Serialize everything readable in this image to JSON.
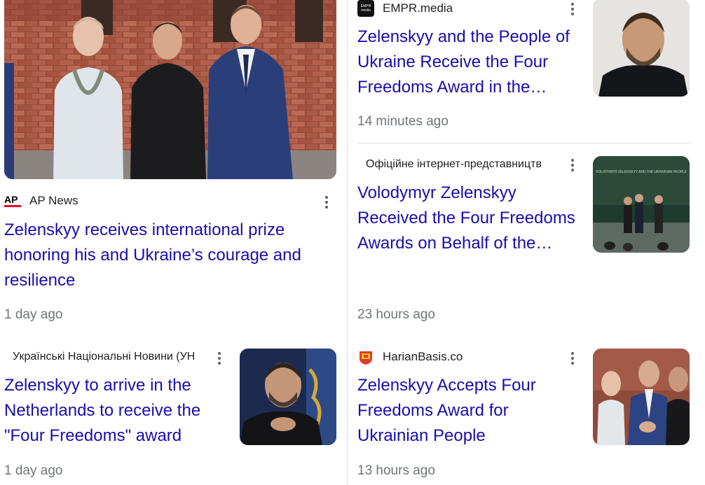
{
  "cards": [
    {
      "source": "AP News",
      "source_logo_text": "AP",
      "headline": "Zelenskyy receives international prize honoring his and Ukraine’s courage and resilience",
      "time": "1 day ago"
    },
    {
      "source": "EMPR.media",
      "source_logo_text": "EMPR media",
      "headline": "Zelenskyy and the People of Ukraine Receive the Four Freedoms Award in the…",
      "time": "14 minutes ago"
    },
    {
      "source": "Офіційне інтернет-представництв",
      "headline": "Volodymyr Zelenskyy Received the Four Freedoms Awards on Behalf of the…",
      "time": "23 hours ago",
      "thumb_caption": "VOLODYMYR ZELENSKYY AND THE UKRAINIAN PEOPLE"
    },
    {
      "source": "Українські Національні Новини (УН",
      "headline": "Zelenskyy to arrive in the Netherlands to receive the \"Four Freedoms\" award",
      "time": "1 day ago"
    },
    {
      "source": "HarianBasis.co",
      "headline": "Zelenskyy Accepts Four Freedoms Award for Ukrainian People",
      "time": "13 hours ago"
    }
  ],
  "colors": {
    "link": "#1a0dab",
    "meta": "#70757a",
    "divider": "#dadce0"
  }
}
